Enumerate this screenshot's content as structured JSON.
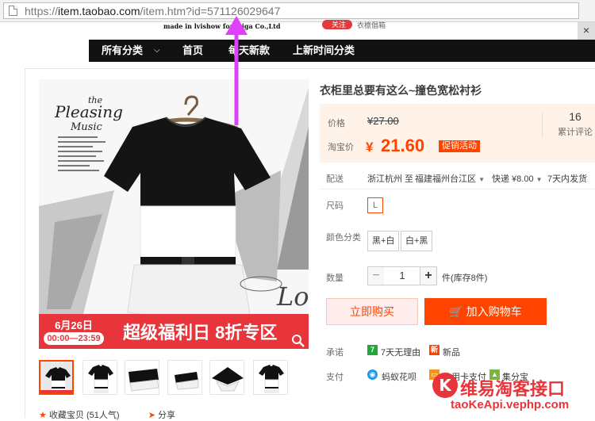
{
  "browser": {
    "url_scheme": "https://",
    "url_host": "item.taobao.com",
    "url_path": "/item.htm?id=571126029647"
  },
  "header": {
    "brand_line": "made in lvishow for laiga Co.,Ltd",
    "fav_label": "关注",
    "shop_name": "衣檩倡箱",
    "close_label": "×"
  },
  "nav": {
    "items": [
      "所有分类",
      "首页",
      "每天新款",
      "上新时间分类"
    ]
  },
  "gallery": {
    "image_texts": {
      "script_title": "Pleasing",
      "script_small": "the",
      "script_sub": "Music",
      "sign_text": "Lo"
    },
    "banner": {
      "date": "6月26日",
      "time": "00:00—23:59",
      "headline": "超级福利日 8折专区"
    },
    "thumb_count": 6,
    "bottom_links": [
      "收藏宝贝 (51人气)",
      "分享"
    ]
  },
  "product": {
    "title": "衣柜里总要有这么~撞色宽松衬衫",
    "price_label": "价格",
    "old_price": "¥27.00",
    "tb_price_label": "淘宝价",
    "currency": "¥",
    "price": "21.60",
    "promo_tag": "促销活动",
    "review_count": "16",
    "review_label": "累计评论",
    "shipping_label": "配送",
    "ship_from": "浙江杭州 至",
    "ship_to": "福建福州台江区",
    "ship_fee": "快递 ¥8.00",
    "ship_time": "7天内发货",
    "size_label": "尺码",
    "size_value": "L",
    "color_label": "颜色分类",
    "colors": [
      "黑+白",
      "白+黑"
    ],
    "qty_label": "数量",
    "qty_value": "1",
    "minus": "−",
    "plus": "+",
    "stock": "件(库存8件)",
    "buy_now": "立即购买",
    "add_cart": "加入购物车",
    "promise_label": "承诺",
    "promise_items": [
      "7天无理由",
      "新品"
    ],
    "pay_label": "支付",
    "pay_items": [
      "蚂蚁花呗",
      "信用卡支付",
      "集分宝"
    ]
  },
  "watermark": {
    "cn": "维易淘客接口",
    "en": "taoKeApi.vephp.com"
  },
  "colors": {
    "accent": "#ff4400",
    "banner_red": "#e8353b",
    "price_bg": "#fff2e8",
    "nav_bg": "#111111",
    "arrow": "#e040fb"
  },
  "icons": [
    "document-icon",
    "zoom-icon",
    "cart-icon",
    "star-icon",
    "share-icon",
    "alipay-icon",
    "arrow-annotation"
  ]
}
